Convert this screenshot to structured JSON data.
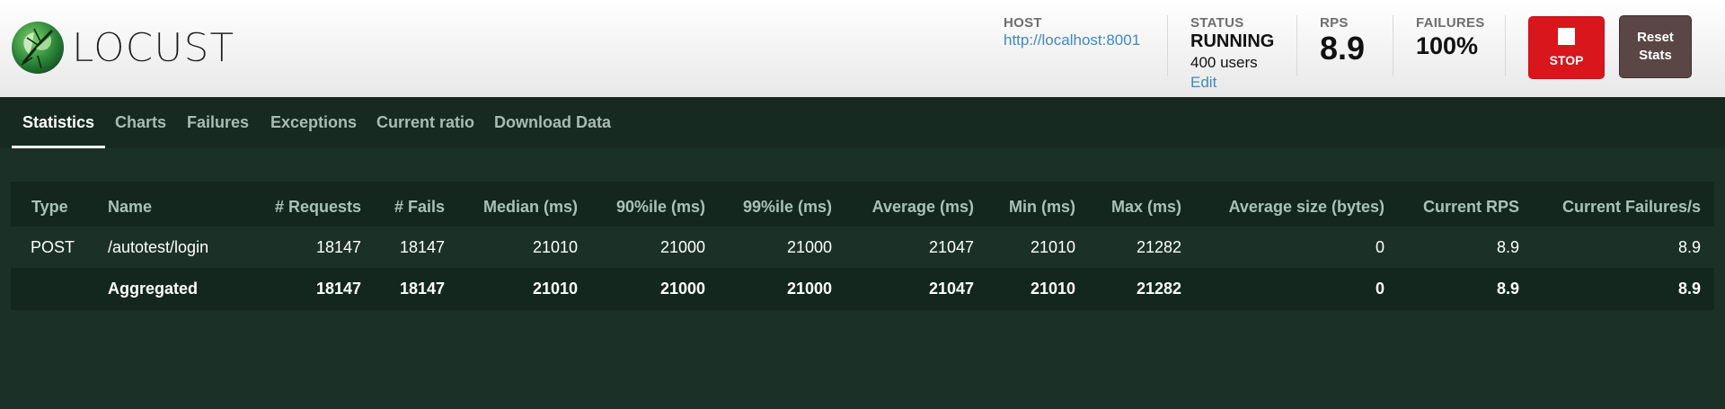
{
  "brand": {
    "name": "LOCUST",
    "logo_icon": "locust-insect-logo"
  },
  "host": {
    "label": "HOST",
    "url": "http://localhost:8001"
  },
  "status": {
    "label": "STATUS",
    "value": "RUNNING",
    "users": "400 users",
    "edit": "Edit"
  },
  "rps": {
    "label": "RPS",
    "value": "8.9"
  },
  "failures": {
    "label": "FAILURES",
    "value": "100%"
  },
  "buttons": {
    "stop": "STOP",
    "reset_line1": "Reset",
    "reset_line2": "Stats"
  },
  "colors": {
    "stop": "#d8161b",
    "reset": "#5a4644",
    "background": "#1b3128",
    "link": "#4188c2"
  },
  "tabs": [
    {
      "label": "Statistics",
      "active": true
    },
    {
      "label": "Charts",
      "active": false
    },
    {
      "label": "Failures",
      "active": false
    },
    {
      "label": "Exceptions",
      "active": false
    },
    {
      "label": "Current ratio",
      "active": false
    },
    {
      "label": "Download Data",
      "active": false
    }
  ],
  "table": {
    "columns": [
      "Type",
      "Name",
      "# Requests",
      "# Fails",
      "Median (ms)",
      "90%ile (ms)",
      "99%ile (ms)",
      "Average (ms)",
      "Min (ms)",
      "Max (ms)",
      "Average size (bytes)",
      "Current RPS",
      "Current Failures/s"
    ],
    "rows": [
      [
        "POST",
        "/autotest/login",
        "18147",
        "18147",
        "21010",
        "21000",
        "21000",
        "21047",
        "21010",
        "21282",
        "0",
        "8.9",
        "8.9"
      ]
    ],
    "aggregated": [
      "",
      "Aggregated",
      "18147",
      "18147",
      "21010",
      "21000",
      "21000",
      "21047",
      "21010",
      "21282",
      "0",
      "8.9",
      "8.9"
    ]
  }
}
